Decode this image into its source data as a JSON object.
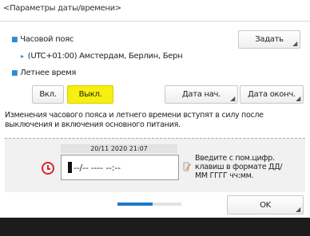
{
  "screen": {
    "title": "<Параметры даты/времени>"
  },
  "timezone": {
    "label": "Часовой пояс",
    "value": "(UTC+01:00) Амстердам, Берлин, Берн",
    "set_button": "Задать"
  },
  "dst": {
    "label": "Летнее время",
    "on_label": "Вкл.",
    "off_label": "Выкл.",
    "selected": "Выкл.",
    "start_date_button": "Дата нач.",
    "end_date_button": "Дата оконч."
  },
  "note": "Изменения часового пояса и летнего времени вступят в силу после выключения и включения основного питания.",
  "datetime": {
    "current": "20/11 2020 21:07",
    "field_value": "--/-- ---- --:--",
    "hint": "Введите с пом.цифр. клавиш в формате ДД/ММ ГГГГ чч:мм."
  },
  "ok_button": "OK",
  "progress": {
    "value": 0.55
  },
  "colors": {
    "accent": "#2e8bd6",
    "selected": "#f6ef10",
    "clock": "#d8262b"
  },
  "icons": {
    "clock": "clock-icon",
    "pencil": "pencil-icon",
    "bullet": "square-bullet-icon"
  }
}
